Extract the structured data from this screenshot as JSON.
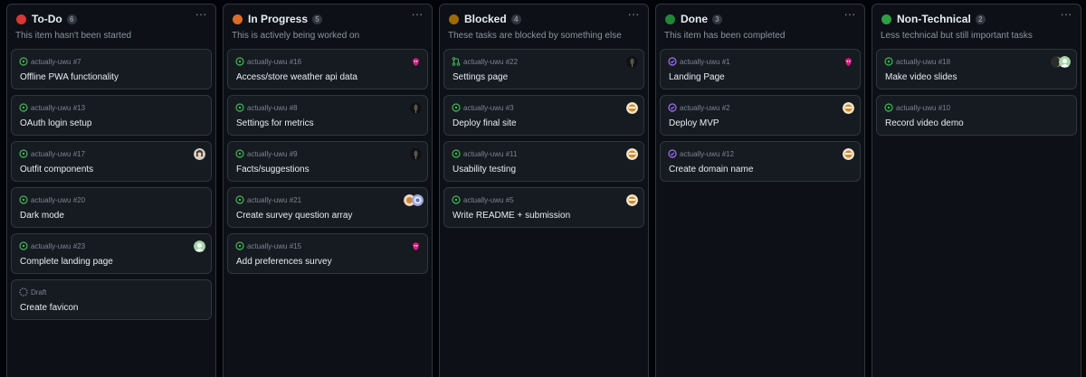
{
  "colors": {
    "todo_dot": "#da3633",
    "inprogress_dot": "#db6d28",
    "blocked_dot": "#9e6a03",
    "done_dot": "#238636",
    "nontech_dot": "#2ea043",
    "open_icon": "#3fb950",
    "done_icon": "#a371f7",
    "draft_icon": "#7d8590"
  },
  "columns": [
    {
      "title": "To-Do",
      "count": "6",
      "description": "This item hasn't been started",
      "cards": [
        {
          "meta": "actually-uwu #7",
          "title": "Offline PWA functionality",
          "status": "open"
        },
        {
          "meta": "actually-uwu #13",
          "title": "OAuth login setup",
          "status": "open"
        },
        {
          "meta": "actually-uwu #17",
          "title": "Outfit components",
          "status": "open"
        },
        {
          "meta": "actually-uwu #20",
          "title": "Dark mode",
          "status": "open"
        },
        {
          "meta": "actually-uwu #23",
          "title": "Complete landing page",
          "status": "open"
        },
        {
          "meta": "Draft",
          "title": "Create favicon",
          "status": "draft"
        }
      ]
    },
    {
      "title": "In Progress",
      "count": "5",
      "description": "This is actively being worked on",
      "cards": [
        {
          "meta": "actually-uwu #16",
          "title": "Access/store weather api data",
          "status": "open"
        },
        {
          "meta": "actually-uwu #8",
          "title": "Settings for metrics",
          "status": "open"
        },
        {
          "meta": "actually-uwu #9",
          "title": "Facts/suggestions",
          "status": "open"
        },
        {
          "meta": "actually-uwu #21",
          "title": "Create survey question array",
          "status": "open"
        },
        {
          "meta": "actually-uwu #15",
          "title": "Add preferences survey",
          "status": "open"
        }
      ]
    },
    {
      "title": "Blocked",
      "count": "4",
      "description": "These tasks are blocked by something else",
      "cards": [
        {
          "meta": "actually-uwu #22",
          "title": "Settings page",
          "status": "pr"
        },
        {
          "meta": "actually-uwu #3",
          "title": "Deploy final site",
          "status": "open"
        },
        {
          "meta": "actually-uwu #11",
          "title": "Usability testing",
          "status": "open"
        },
        {
          "meta": "actually-uwu #5",
          "title": "Write README + submission",
          "status": "open"
        }
      ]
    },
    {
      "title": "Done",
      "count": "3",
      "description": "This item has been completed",
      "cards": [
        {
          "meta": "actually-uwu #1",
          "title": "Landing Page",
          "status": "done"
        },
        {
          "meta": "actually-uwu #2",
          "title": "Deploy MVP",
          "status": "done"
        },
        {
          "meta": "actually-uwu #12",
          "title": "Create domain name",
          "status": "done"
        }
      ]
    },
    {
      "title": "Non-Technical",
      "count": "2",
      "description": "Less technical but still important tasks",
      "cards": [
        {
          "meta": "actually-uwu #18",
          "title": "Make video slides",
          "status": "open"
        },
        {
          "meta": "actually-uwu #10",
          "title": "Record video demo",
          "status": "open"
        }
      ]
    }
  ]
}
